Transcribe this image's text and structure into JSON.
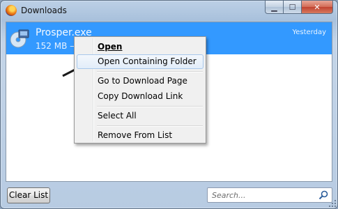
{
  "window": {
    "title": "Downloads"
  },
  "caption": {
    "minimize": "▁",
    "maximize": "☐",
    "close": "✕"
  },
  "download": {
    "file_name": "Prosper.exe",
    "size": "152 MB —",
    "date": "Yesterday",
    "icon": "installer-disc-icon"
  },
  "context_menu": {
    "items": [
      {
        "label": "Open"
      },
      {
        "label": "Open Containing Folder"
      },
      {
        "label": "Go to Download Page"
      },
      {
        "label": "Copy Download Link"
      },
      {
        "label": "Select All"
      },
      {
        "label": "Remove From List"
      }
    ]
  },
  "footer": {
    "clear_label": "Clear List",
    "search_placeholder": "Search..."
  },
  "colors": {
    "selection": "#3399ff",
    "menu_bg": "#f0f0f0"
  }
}
